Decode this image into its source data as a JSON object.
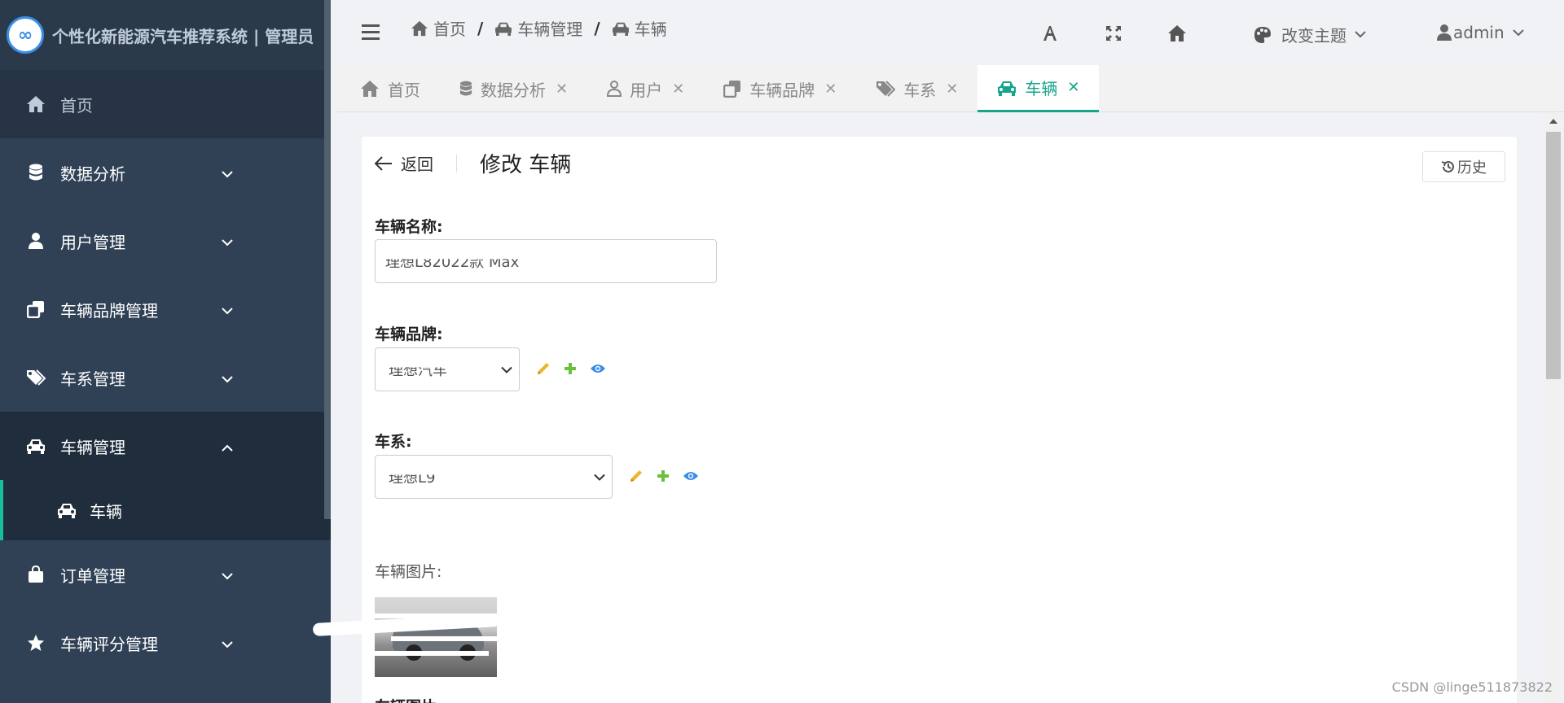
{
  "sidebar": {
    "logo_text": "个性化新能源汽车推荐系统 | 管理员",
    "logo_mark": "∞",
    "items": [
      {
        "label": "首页",
        "icon": "home-icon"
      },
      {
        "label": "数据分析",
        "icon": "database-icon"
      },
      {
        "label": "用户管理",
        "icon": "user-icon"
      },
      {
        "label": "车辆品牌管理",
        "icon": "copy-icon"
      },
      {
        "label": "车系管理",
        "icon": "tags-icon"
      },
      {
        "label": "车辆管理",
        "icon": "car-icon"
      },
      {
        "label": "订单管理",
        "icon": "bag-icon"
      },
      {
        "label": "车辆评分管理",
        "icon": "star-icon"
      }
    ],
    "sub_items": [
      {
        "label": "车辆",
        "icon": "car-icon"
      }
    ]
  },
  "header": {
    "breadcrumb": [
      {
        "label": "首页",
        "icon": "home-icon"
      },
      {
        "label": "车辆管理",
        "icon": "car-icon"
      },
      {
        "label": "车辆",
        "icon": "car-icon"
      }
    ],
    "theme_label": "改变主题",
    "user_label": "admin"
  },
  "tabs": [
    {
      "label": "首页",
      "closable": false
    },
    {
      "label": "数据分析",
      "closable": true
    },
    {
      "label": "用户",
      "closable": true
    },
    {
      "label": "车辆品牌",
      "closable": true
    },
    {
      "label": "车系",
      "closable": true
    },
    {
      "label": "车辆",
      "closable": true,
      "active": true
    }
  ],
  "form": {
    "back_label": "返回",
    "title": "修改 车辆",
    "history_label": "历史",
    "name_label": "车辆名称:",
    "name_value": "理想L82022款 Max",
    "brand_label": "车辆品牌:",
    "brand_value": "理想汽车",
    "series_label": "车系:",
    "series_value": "理想L9",
    "image_label": "车辆图片:",
    "image2_label": "车辆图片"
  },
  "watermark": "CSDN @linge511873822",
  "colors": {
    "accent": "#16a58a",
    "sidebar_bg": "#304156",
    "edit": "#f0b429",
    "add": "#67c23a",
    "view": "#3a8ee6"
  }
}
